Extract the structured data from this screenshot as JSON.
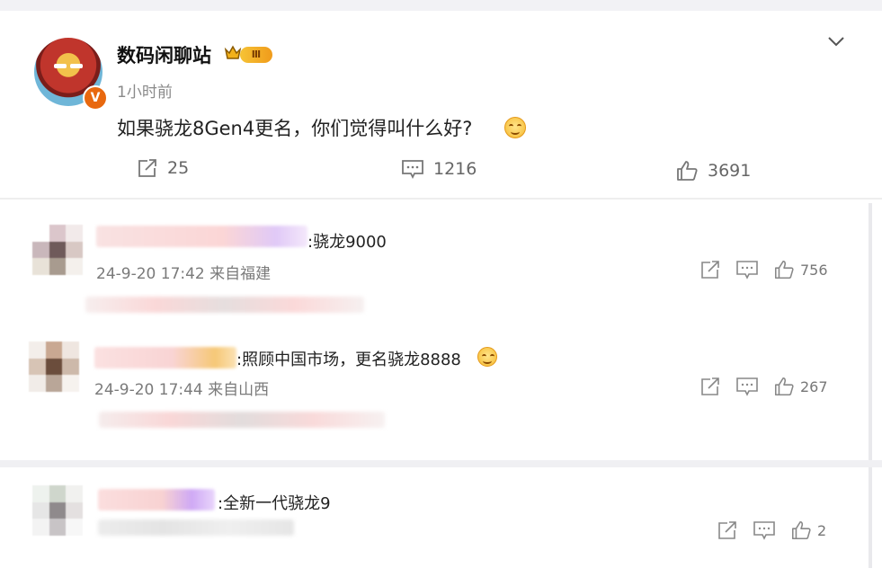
{
  "post": {
    "username": "数码闲聊站",
    "level_badge": "Ⅲ",
    "verified_badge": "V",
    "time": "1小时前",
    "text": "如果骁龙8Gen4更名，你们觉得叫什么好?",
    "reposts": "25",
    "comments": "1216",
    "likes": "3691",
    "icons": [
      "crown-icon",
      "chevron-down-icon",
      "repost-icon",
      "comment-icon",
      "like-icon",
      "smile-emoji-icon"
    ],
    "colors": {
      "verified": "#e8680f",
      "level_badge": "#f6c335"
    }
  },
  "comments": [
    {
      "text": ":骁龙9000",
      "meta": "24-9-20 17:42 来自福建",
      "likes": "756"
    },
    {
      "text": ":照顾中国市场，更名骁龙8888",
      "meta": "24-9-20 17:44 来自山西",
      "likes": "267"
    },
    {
      "text": ":全新一代骁龙9",
      "likes": "2"
    }
  ]
}
